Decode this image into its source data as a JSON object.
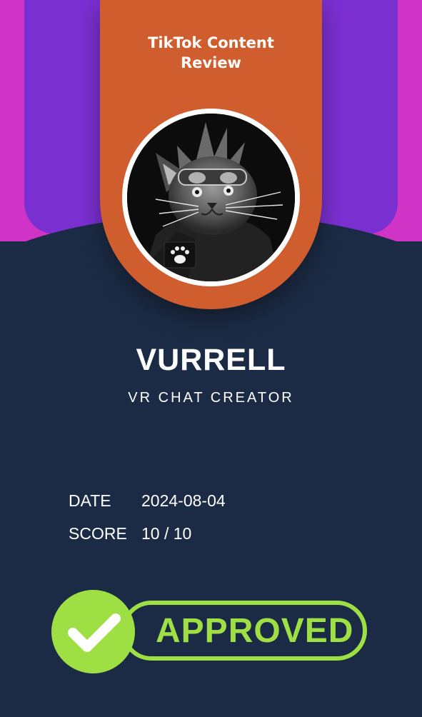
{
  "header": {
    "title": "TikTok Content\nReview"
  },
  "profile": {
    "avatar_icon": "cat-vr-avatar",
    "badge_icon": "paw-icon",
    "name": "VURRELL",
    "role": "VR CHAT CREATOR"
  },
  "details": [
    {
      "label": "DATE",
      "value": "2024-08-04"
    },
    {
      "label": "SCORE",
      "value": "10 / 10"
    }
  ],
  "status": {
    "icon": "checkmark-icon",
    "label": "APPROVED"
  },
  "colors": {
    "background": "#1c2b45",
    "ribbon": "#cf5d2e",
    "purple": "#7a2fd0",
    "magenta": "#d034c6",
    "approved_green": "#9ee044"
  }
}
